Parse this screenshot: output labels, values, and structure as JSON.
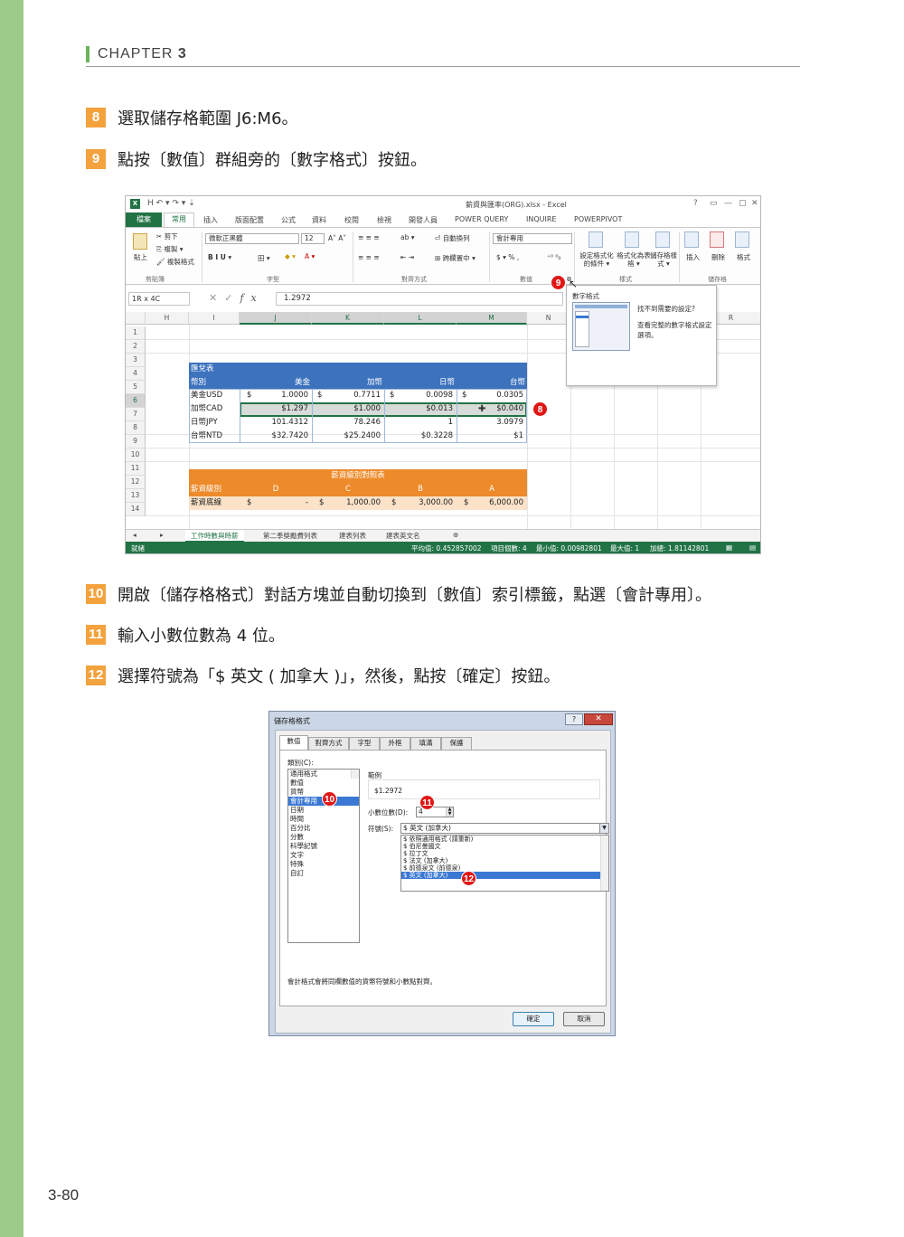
{
  "chapter": {
    "prefix": "CHAPTER",
    "number": "3"
  },
  "steps": [
    {
      "num": "8",
      "text": "選取儲存格範圍 J6:M6。"
    },
    {
      "num": "9",
      "text": "點按〔數值〕群組旁的〔數字格式〕按鈕。"
    },
    {
      "num": "10",
      "text": "開啟〔儲存格格式〕對話方塊並自動切換到〔數值〕索引標籤，點選〔會計專用〕。"
    },
    {
      "num": "11",
      "text": "輸入小數位數為 4 位。"
    },
    {
      "num": "12",
      "text": "選擇符號為「$ 英文 ( 加拿大 )」，然後，點按〔確定〕按鈕。"
    }
  ],
  "page_number": "3-80",
  "excel": {
    "qat": "H  ↶ ▾  ↷ ▾  ⇣",
    "title": "薪資與匯率(ORG).xlsx - Excel",
    "win_buttons": [
      "?",
      "▭",
      "—",
      "▢",
      "✕"
    ],
    "tabs": [
      "檔案",
      "常用",
      "插入",
      "版面配置",
      "公式",
      "資料",
      "校閱",
      "檢視",
      "開發人員",
      "POWER QUERY",
      "INQUIRE",
      "POWERPIVOT"
    ],
    "ribbon": {
      "paste": "貼上",
      "cut": "剪下",
      "copy": "複製 ▾",
      "format_painter": "複製格式",
      "clipboard": "剪貼簿",
      "font_name": "微軟正黑體",
      "font_size": "12",
      "font_group": "字型",
      "font_styles": "B  I  U ▾",
      "align_group": "對齊方式",
      "wrap": "自動換列",
      "merge": "跨欄置中 ▾",
      "number_format": "會計專用",
      "number_symbols": "$ ▾  %  ,",
      "number_group": "數值",
      "cond_format": "設定格式化的條件 ▾",
      "as_table": "格式化為表格 ▾",
      "cell_styles": "儲存格樣式 ▾",
      "styles_group": "樣式",
      "insert": "插入",
      "delete": "刪除",
      "format": "格式",
      "cells_group": "儲存格"
    },
    "name_box": "1R x 4C",
    "formula_value": "1.2972",
    "columns": [
      "H",
      "I",
      "J",
      "K",
      "L",
      "M",
      "N",
      "O",
      "P",
      "Q",
      "R"
    ],
    "rows": [
      "1",
      "2",
      "3",
      "4",
      "5",
      "6",
      "7",
      "8",
      "9",
      "10",
      "11",
      "12",
      "13",
      "14"
    ],
    "table1": {
      "title": "匯兌表",
      "header": [
        "幣別",
        "美金",
        "加幣",
        "日幣",
        "台幣"
      ],
      "rows": [
        [
          "美金USD",
          "$",
          "1.0000",
          "$",
          "0.7711",
          "$",
          "0.0098",
          "$",
          "0.0305"
        ],
        [
          "加幣CAD",
          "",
          "$1.297",
          "",
          "$1.000",
          "",
          "$0.013",
          "",
          "$0.040"
        ],
        [
          "日幣JPY",
          "",
          "101.4312",
          "",
          "78.246",
          "",
          "1",
          "",
          "3.0979"
        ],
        [
          "台幣NTD",
          "",
          "$32.7420",
          "",
          "$25.2400",
          "",
          "$0.3228",
          "",
          "$1"
        ]
      ]
    },
    "table2": {
      "title": "薪資級別對照表",
      "header": [
        "薪資級別",
        "D",
        "C",
        "B",
        "A"
      ],
      "row": [
        "薪資底線",
        "$",
        "-",
        "$",
        "1,000.00",
        "$",
        "3,000.00",
        "$",
        "6,000.00"
      ]
    },
    "popup": {
      "title": "數字格式",
      "question": "找不到需要的設定?",
      "desc": "查看完整的數字格式設定選項。"
    },
    "sheets": [
      "工作時數與時薪",
      "第二季獎勵費列表",
      "建表列表",
      "建表英文名"
    ],
    "status": {
      "ready": "就緒",
      "average": "平均值: 0.452857002",
      "count": "項目個數: 4",
      "min": "最小值: 0.00982801",
      "max": "最大值: 1",
      "sum": "加總: 1.81142801"
    },
    "markers": {
      "range": "8",
      "launcher": "9"
    }
  },
  "dialog": {
    "title": "儲存格格式",
    "help": "?",
    "close": "✕",
    "tabs": [
      "數值",
      "對齊方式",
      "字型",
      "外框",
      "填滿",
      "保護"
    ],
    "category_label": "類別(C):",
    "categories": [
      "通用格式",
      "數值",
      "貨幣",
      "會計專用",
      "日期",
      "時間",
      "百分比",
      "分數",
      "科學記號",
      "文字",
      "特殊",
      "自訂"
    ],
    "sample_label": "範例",
    "sample_value": "$1.2972",
    "decimals_label": "小數位數(D):",
    "decimals_value": "4",
    "symbol_label": "符號(S):",
    "symbol_value": "$ 英文 (加拿大)",
    "symbol_list": [
      "$ 依照通用格式 (請重新)",
      "$ 伯尼曼國文",
      "$ 拉丁文",
      "$ 法文 (加拿大)",
      "$ 前德泉文 (前德泉)",
      "$ 英文 (加拿大)"
    ],
    "description": "會計格式會將同欄數值的貨幣符號和小數點對齊。",
    "ok": "確定",
    "cancel": "取消",
    "markers": {
      "category": "10",
      "decimals": "11",
      "symbol": "12"
    }
  }
}
